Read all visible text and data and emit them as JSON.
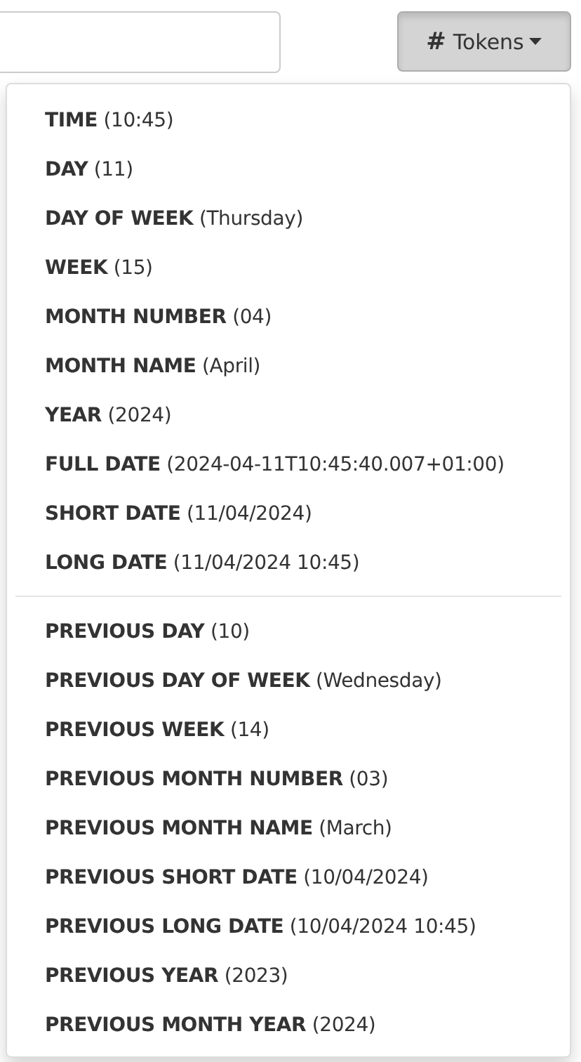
{
  "toolbar": {
    "tokens_button": {
      "icon": "#",
      "label": "Tokens",
      "expanded": true
    }
  },
  "menu": {
    "groups": [
      [
        {
          "label": "**TIME** (10:45)"
        },
        {
          "label": "**DAY** (11)"
        },
        {
          "label": "**DAY OF WEEK** (Thursday)"
        },
        {
          "label": "**WEEK** (15)"
        },
        {
          "label": "**MONTH NUMBER** (04)"
        },
        {
          "label": "**MONTH NAME** (April)"
        },
        {
          "label": "**YEAR** (2024)"
        },
        {
          "label": "**FULL DATE** (2024-04-11T10:45:40.007+01:00)"
        },
        {
          "label": "**SHORT DATE** (11/04/2024)"
        },
        {
          "label": "**LONG DATE** (11/04/2024 10:45)"
        }
      ],
      [
        {
          "label": "**PREVIOUS DAY** (10)"
        },
        {
          "label": "**PREVIOUS DAY OF WEEK** (Wednesday)"
        },
        {
          "label": "**PREVIOUS WEEK** (14)"
        },
        {
          "label": "**PREVIOUS MONTH NUMBER** (03)"
        },
        {
          "label": "**PREVIOUS MONTH NAME** (March)"
        },
        {
          "label": "**PREVIOUS SHORT DATE** (10/04/2024)"
        },
        {
          "label": "**PREVIOUS LONG DATE** (10/04/2024 10:45)"
        },
        {
          "label": "**PREVIOUS YEAR** (2023)"
        },
        {
          "label": "**PREVIOUS MONTH YEAR** (2024)"
        }
      ]
    ]
  }
}
